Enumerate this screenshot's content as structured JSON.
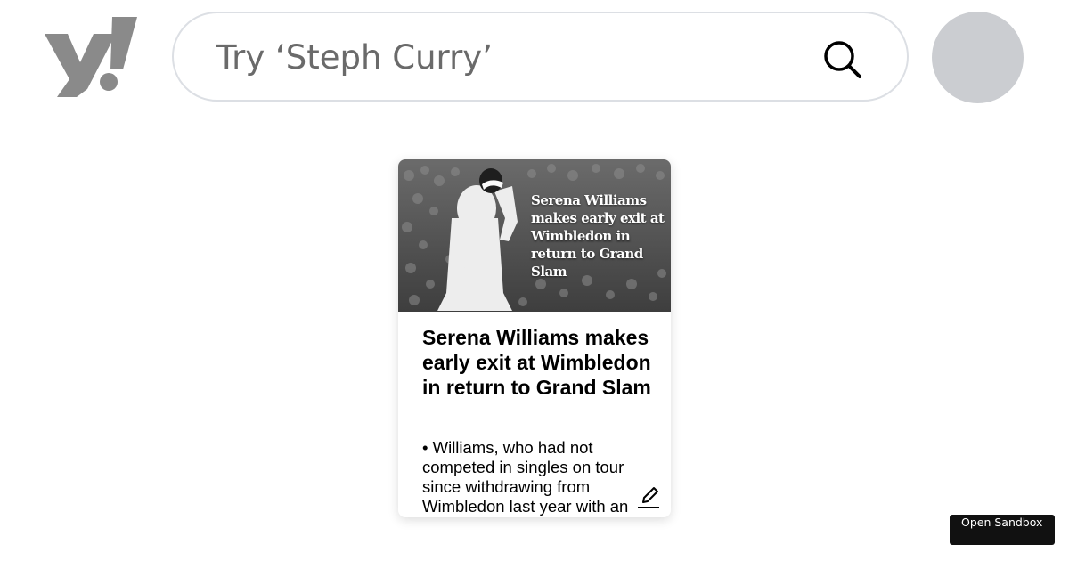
{
  "header": {
    "logo_alt": "y!",
    "search": {
      "placeholder": "Try ‘Steph Curry’",
      "value": ""
    }
  },
  "card": {
    "image_overlay_title": "Serena Williams makes early exit at Wimbledon in return to Grand Slam",
    "headline": "Serena Williams makes early exit at Wimbledon in return to Grand Slam",
    "summary": "• Williams, who had not competed in singles on tour since withdrawing from Wimbledon last year with an"
  },
  "sandbox_button": {
    "label": "Open Sandbox"
  },
  "colors": {
    "logo": "#8a8a8a",
    "search_border": "#dcdfe4",
    "avatar": "#cbcdd1",
    "sandbox_bg": "#111111"
  },
  "icons": {
    "search": "search-icon",
    "edit": "edit-pencil-icon",
    "logo": "yahoo-logo-icon"
  }
}
